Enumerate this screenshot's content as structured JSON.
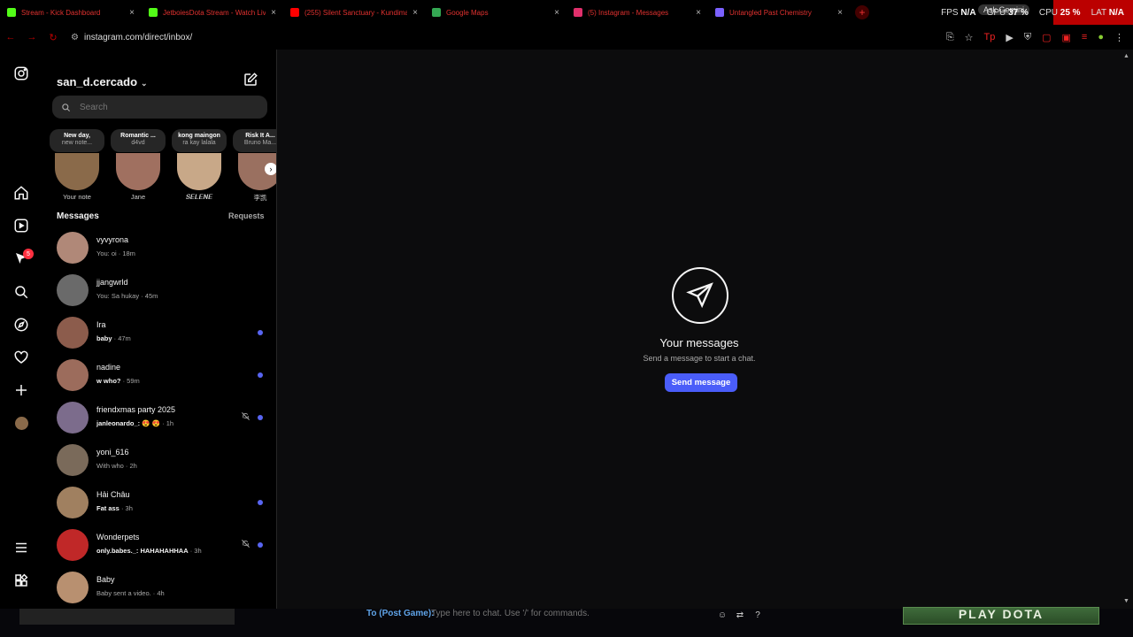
{
  "browser": {
    "tabs": [
      {
        "title": "Stream - Kick Dashboard",
        "color": "#53fc18"
      },
      {
        "title": "JetboiesDota Stream - Watch Live",
        "color": "#53fc18"
      },
      {
        "title": "(255) Silent Sanctuary - Kundiman",
        "color": "#ff0000"
      },
      {
        "title": "Google Maps",
        "color": "#34a853"
      },
      {
        "title": "(5) Instagram - Messages",
        "color": "#e1306c"
      },
      {
        "title": "Untangled Past Chemistry",
        "color": "#7b61ff"
      }
    ],
    "url": "instagram.com/direct/inbox/",
    "ask_gemini": "Ask Gemini"
  },
  "overlay_stats": {
    "fps_label": "FPS",
    "fps_value": "N/A",
    "gpu_label": "GPU",
    "gpu_value": "37 %",
    "cpu_label": "CPU",
    "cpu_value": "25 %",
    "lat_label": "LAT",
    "lat_value": "N/A"
  },
  "rail": {
    "messages_badge": "5"
  },
  "inbox": {
    "username": "san_d.cercado",
    "search_placeholder": "Search",
    "notes": [
      {
        "line1": "New day,",
        "line2": "new note...",
        "name": "Your note",
        "avatar_color": "#8a6a4a"
      },
      {
        "line1": "Romantic ...",
        "line2": "d4vd",
        "name": "Jane",
        "avatar_color": "#a07060"
      },
      {
        "line1": "kong maingon",
        "line2": "ra kay lalala",
        "name": "𝑺𝑬𝑳𝑬𝑵𝑬",
        "avatar_color": "#c8a888"
      },
      {
        "line1": "Risk It A...",
        "line2": "Bruno Ma...",
        "name": "李凯",
        "avatar_color": "#9a7060"
      }
    ],
    "messages_label": "Messages",
    "requests_label": "Requests",
    "threads": [
      {
        "name": "vyvyrona",
        "preview": "You: oi",
        "time": "18m",
        "unread": false,
        "muted": false,
        "avatar_color": "#b08878"
      },
      {
        "name": "jjangwrld",
        "preview": "You: Sa hukay",
        "time": "45m",
        "unread": false,
        "muted": false,
        "avatar_color": "#6a6a6a"
      },
      {
        "name": "Ira",
        "preview": "baby",
        "time": "47m",
        "unread": true,
        "muted": false,
        "avatar_color": "#8c5c4c"
      },
      {
        "name": "nadine",
        "preview": "w who?",
        "time": "59m",
        "unread": true,
        "muted": false,
        "avatar_color": "#9c6c5c"
      },
      {
        "name": "friendxmas party 2025",
        "preview": "janleonardo_: 😍 😍",
        "time": "1h",
        "unread": true,
        "muted": true,
        "avatar_color": "#7c6c8c"
      },
      {
        "name": "yoni_616",
        "preview": "With who",
        "time": "2h",
        "unread": false,
        "muted": false,
        "avatar_color": "#7a6a5a"
      },
      {
        "name": "Hải Châu",
        "preview": "Fat ass",
        "time": "3h",
        "unread": true,
        "muted": false,
        "avatar_color": "#a08060"
      },
      {
        "name": "Wonderpets",
        "preview": "only.babes._: HAHAHAHHAA",
        "time": "3h",
        "unread": true,
        "muted": true,
        "avatar_color": "#c02828"
      },
      {
        "name": "Baby",
        "preview": "Baby sent a video.",
        "time": "4h",
        "unread": false,
        "muted": false,
        "avatar_color": "#b89070"
      }
    ]
  },
  "main": {
    "title": "Your messages",
    "subtitle": "Send a message to start a chat.",
    "button": "Send message"
  },
  "game": {
    "chat_to": "To (Post Game):",
    "chat_placeholder": "Type here to chat. Use '/' for commands.",
    "play_button": "PLAY DOTA"
  }
}
